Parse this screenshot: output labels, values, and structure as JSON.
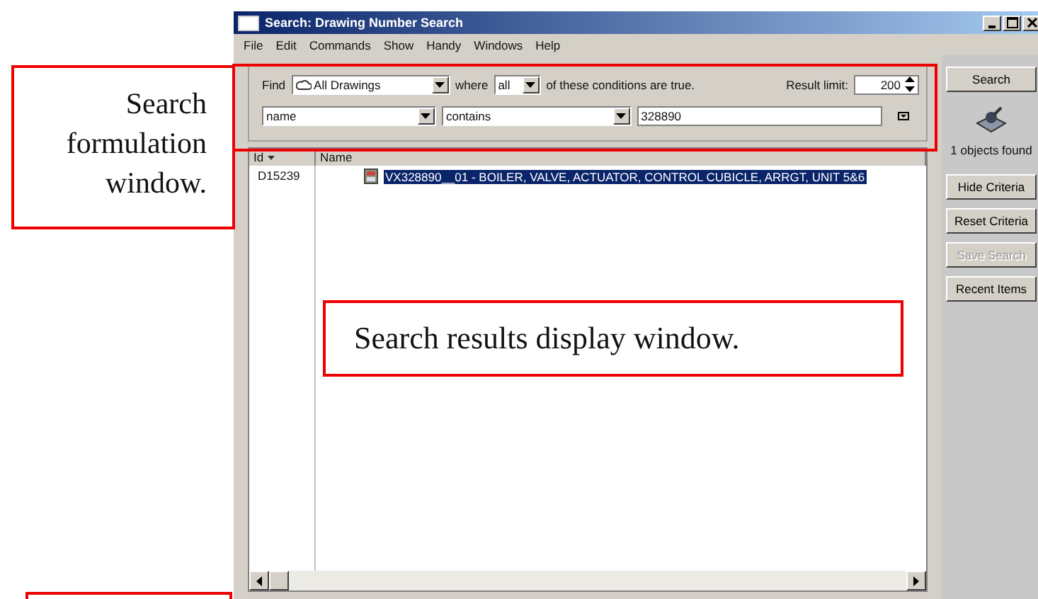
{
  "window": {
    "title": "Search: Drawing Number Search"
  },
  "menu": [
    "File",
    "Edit",
    "Commands",
    "Show",
    "Handy",
    "Windows",
    "Help"
  ],
  "search": {
    "find_label": "Find",
    "find_value": "All Drawings",
    "where_label": "where",
    "where_value": "all",
    "conditions_text": "of these conditions are true.",
    "result_limit_label": "Result limit:",
    "result_limit": "200",
    "field": "name",
    "operator": "contains",
    "value": "328890"
  },
  "results": {
    "columns": [
      "Id",
      "Name"
    ],
    "rows": [
      {
        "id": "D15239",
        "name": "VX328890__01 - BOILER, VALVE, ACTUATOR, CONTROL CUBICLE, ARRGT, UNIT 5&6",
        "selected": true
      }
    ]
  },
  "sidebar": {
    "buttons": [
      {
        "label": "Search",
        "disabled": false
      },
      {
        "label": "Hide Criteria",
        "disabled": false
      },
      {
        "label": "Reset Criteria",
        "disabled": false
      },
      {
        "label": "Save Search",
        "disabled": true
      },
      {
        "label": "Recent Items",
        "disabled": false
      }
    ],
    "status": "1 objects found"
  },
  "callouts": [
    {
      "kind": "formulation",
      "text": "Search formulation window."
    },
    {
      "kind": "results",
      "text": "Search results display window."
    }
  ]
}
